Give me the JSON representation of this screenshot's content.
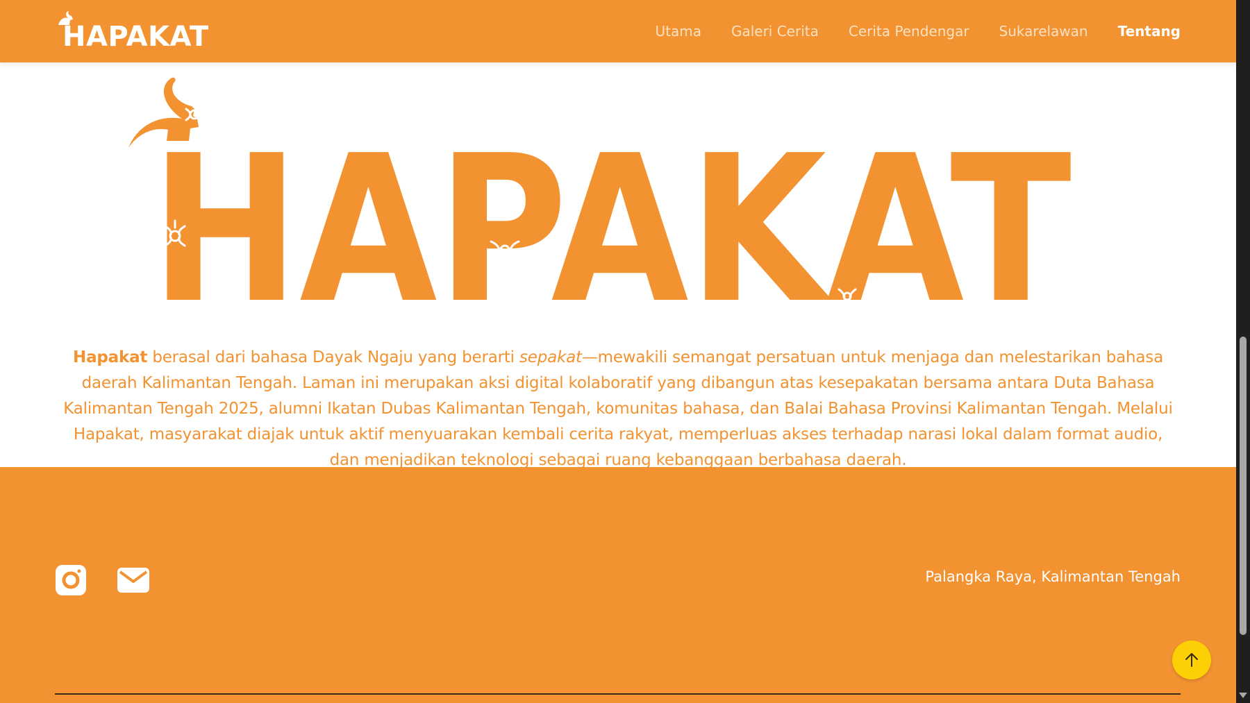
{
  "colors": {
    "accent": "#f29230",
    "scroll_top_button": "#fdd006"
  },
  "header": {
    "brand": "HAPAKAT",
    "nav": [
      {
        "label": "Utama"
      },
      {
        "label": "Galeri Cerita"
      },
      {
        "label": "Cerita Pendengar"
      },
      {
        "label": "Sukarelawan"
      },
      {
        "label": "Tentang",
        "active": true
      }
    ]
  },
  "hero": {
    "wordmark": "HAPAKAT"
  },
  "about": {
    "highlight": "Hapakat",
    "text_1": " berasal dari bahasa Dayak Ngaju yang berarti ",
    "italic": "sepakat",
    "text_2": "—mewakili semangat persatuan untuk menjaga dan melestarikan bahasa daerah Kalimantan Tengah. Laman ini merupakan aksi digital kolaboratif yang dibangun atas kesepakatan bersama antara Duta Bahasa Kalimantan Tengah 2025, alumni Ikatan Dubas Kalimantan Tengah, komunitas bahasa, dan Balai Bahasa Provinsi Kalimantan Tengah. Melalui Hapakat, masyarakat diajak untuk aktif menyuarakan kembali cerita rakyat, memperluas akses terhadap narasi lokal dalam format audio, dan menjadikan teknologi sebagai ruang kebanggaan berbahasa daerah."
  },
  "footer": {
    "social_icons": [
      "instagram-icon",
      "mail-icon"
    ],
    "location": "Palangka Raya, Kalimantan Tengah"
  },
  "scroll_top_icon": "arrow-up-icon"
}
